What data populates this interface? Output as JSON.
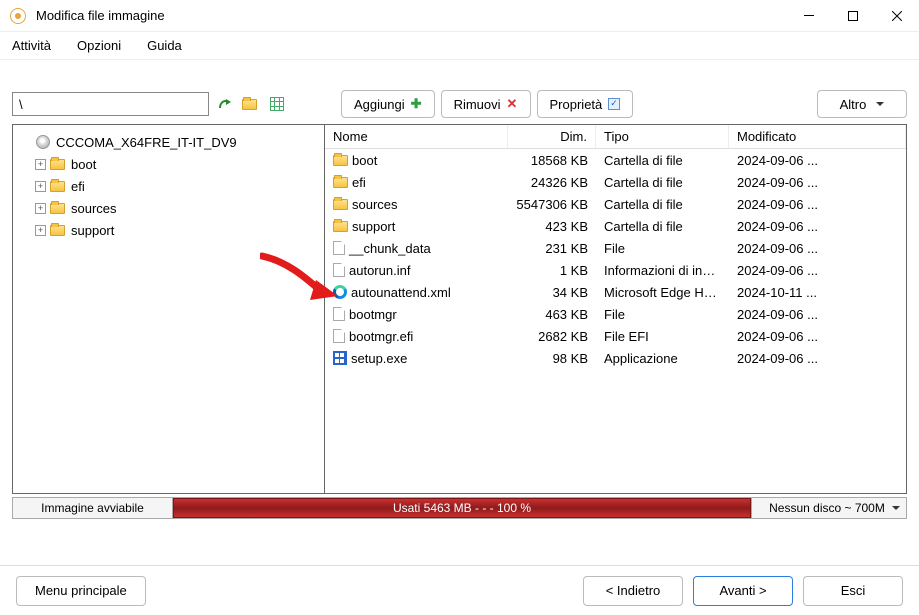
{
  "title": "Modifica file immagine",
  "menu": {
    "activities": "Attività",
    "options": "Opzioni",
    "help": "Guida"
  },
  "path": "\\",
  "toolbar": {
    "add": "Aggiungi",
    "remove": "Rimuovi",
    "properties": "Proprietà",
    "more": "Altro"
  },
  "tree": {
    "root": "CCCOMA_X64FRE_IT-IT_DV9",
    "children": [
      {
        "name": "boot"
      },
      {
        "name": "efi"
      },
      {
        "name": "sources"
      },
      {
        "name": "support"
      }
    ]
  },
  "columns": {
    "name": "Nome",
    "size": "Dim.",
    "type": "Tipo",
    "modified": "Modificato"
  },
  "rows": [
    {
      "icon": "folder",
      "name": "boot",
      "size": "18568 KB",
      "type": "Cartella di file",
      "mod": "2024-09-06 ..."
    },
    {
      "icon": "folder",
      "name": "efi",
      "size": "24326 KB",
      "type": "Cartella di file",
      "mod": "2024-09-06 ..."
    },
    {
      "icon": "folder",
      "name": "sources",
      "size": "5547306 KB",
      "type": "Cartella di file",
      "mod": "2024-09-06 ..."
    },
    {
      "icon": "folder",
      "name": "support",
      "size": "423 KB",
      "type": "Cartella di file",
      "mod": "2024-09-06 ..."
    },
    {
      "icon": "file",
      "name": "__chunk_data",
      "size": "231 KB",
      "type": "File",
      "mod": "2024-09-06 ..."
    },
    {
      "icon": "file",
      "name": "autorun.inf",
      "size": "1 KB",
      "type": "Informazioni di install...",
      "mod": "2024-09-06 ..."
    },
    {
      "icon": "edge",
      "name": "autounattend.xml",
      "size": "34 KB",
      "type": "Microsoft Edge HTM...",
      "mod": "2024-10-11 ..."
    },
    {
      "icon": "file",
      "name": "bootmgr",
      "size": "463 KB",
      "type": "File",
      "mod": "2024-09-06 ..."
    },
    {
      "icon": "file",
      "name": "bootmgr.efi",
      "size": "2682 KB",
      "type": "File EFI",
      "mod": "2024-09-06 ..."
    },
    {
      "icon": "exe",
      "name": "setup.exe",
      "size": "98 KB",
      "type": "Applicazione",
      "mod": "2024-09-06 ..."
    }
  ],
  "status": {
    "bootable": "Immagine avviabile",
    "usage": "Usati  5463 MB   - - -   100 %",
    "disc": "Nessun disco ~ 700M"
  },
  "footer": {
    "mainmenu": "Menu principale",
    "back": "<  Indietro",
    "next": "Avanti  >",
    "exit": "Esci"
  }
}
